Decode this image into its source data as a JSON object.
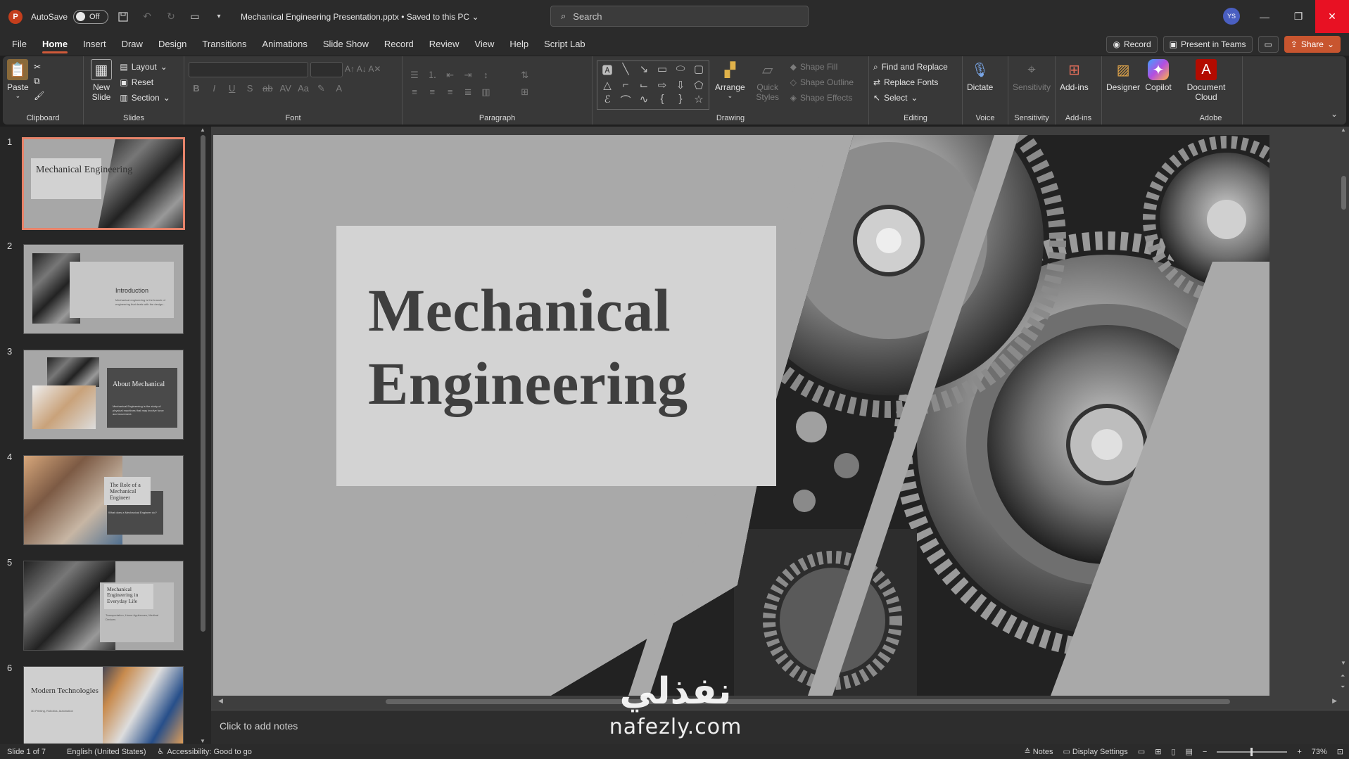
{
  "titlebar": {
    "autosave_label": "AutoSave",
    "autosave_state": "Off",
    "document_title": "Mechanical Engineering Presentation.pptx • Saved to this PC",
    "search_placeholder": "Search",
    "avatar_initials": "YS",
    "app_icon": "P"
  },
  "menu": {
    "items": [
      "File",
      "Home",
      "Insert",
      "Draw",
      "Design",
      "Transitions",
      "Animations",
      "Slide Show",
      "Record",
      "Review",
      "View",
      "Help",
      "Script Lab"
    ],
    "active": "Home",
    "record_label": "Record",
    "present_teams_label": "Present in Teams",
    "share_label": "Share"
  },
  "ribbon": {
    "clipboard": {
      "paste": "Paste",
      "label": "Clipboard"
    },
    "slides": {
      "new_slide": "New Slide",
      "layout": "Layout",
      "reset": "Reset",
      "section": "Section",
      "label": "Slides"
    },
    "font": {
      "label": "Font"
    },
    "paragraph": {
      "label": "Paragraph"
    },
    "drawing": {
      "arrange": "Arrange",
      "quick_styles": "Quick Styles",
      "shape_fill": "Shape Fill",
      "shape_outline": "Shape Outline",
      "shape_effects": "Shape Effects",
      "label": "Drawing"
    },
    "editing": {
      "find_replace": "Find and Replace",
      "replace_fonts": "Replace Fonts",
      "select": "Select",
      "label": "Editing"
    },
    "voice": {
      "dictate": "Dictate",
      "label": "Voice"
    },
    "sensitivity": {
      "sensitivity": "Sensitivity",
      "label": "Sensitivity"
    },
    "addins": {
      "addins": "Add-ins",
      "label": "Add-ins"
    },
    "designer": "Designer",
    "copilot": "Copilot",
    "adobe": {
      "document_cloud": "Document Cloud",
      "label": "Adobe"
    }
  },
  "thumbnails": [
    {
      "num": "1",
      "title": "Mechanical Engineering",
      "body": ""
    },
    {
      "num": "2",
      "title": "Introduction",
      "body": "Mechanical engineering is the branch of engineering that deals with the design..."
    },
    {
      "num": "3",
      "title": "About Mechanical",
      "body": "Mechanical Engineering is the study of physical machines that may involve force and movement."
    },
    {
      "num": "4",
      "title": "The Role of a Mechanical Engineer",
      "body": "What does a Mechanical Engineer do?"
    },
    {
      "num": "5",
      "title": "Mechanical Engineering in Everyday Life",
      "body": "Transportation, Home Appliances, Medical Devices"
    },
    {
      "num": "6",
      "title": "Modern Technologies",
      "body": "3D Printing, Robotics, Automation"
    }
  ],
  "slide": {
    "title_line1": "Mechanical",
    "title_line2": "Engineering"
  },
  "notes": {
    "placeholder": "Click to add notes"
  },
  "watermark": {
    "arabic": "نفذلي",
    "latin": "nafezly.com"
  },
  "status": {
    "slide_info": "Slide 1 of 7",
    "language": "English (United States)",
    "accessibility": "Accessibility: Good to go",
    "notes": "Notes",
    "display_settings": "Display Settings",
    "zoom": "73%"
  },
  "colors": {
    "accent": "#c8552f",
    "selected_thumb": "#e6836a",
    "close": "#e81123"
  }
}
